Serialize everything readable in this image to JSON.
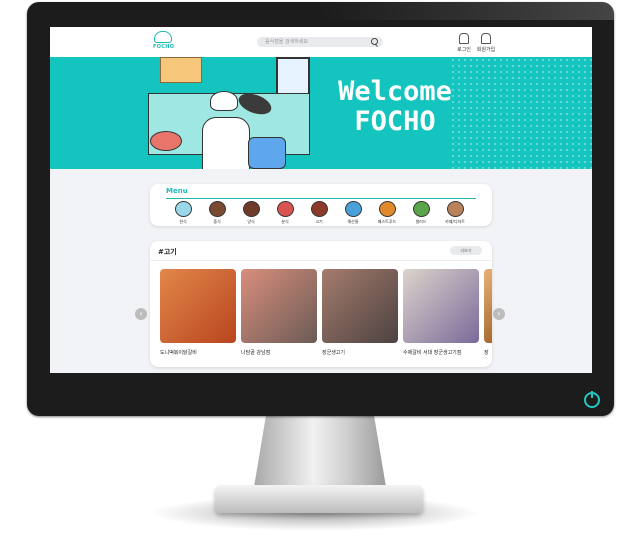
{
  "header": {
    "logo_text": "FOCHO",
    "search_placeholder": "음식점을 검색하세요",
    "actions": [
      {
        "label": "로그인",
        "icon": "user-icon"
      },
      {
        "label": "회원가입",
        "icon": "user-add-icon"
      }
    ]
  },
  "hero": {
    "title_line1": "Welcome",
    "title_line2": "FOCHO"
  },
  "menu": {
    "title": "Menu",
    "items": [
      {
        "label": "한식",
        "icon": "rice-bowl-icon",
        "color": "#9bd7ea"
      },
      {
        "label": "중식",
        "icon": "noodle-icon",
        "color": "#7a4a33"
      },
      {
        "label": "양식",
        "icon": "steak-icon",
        "color": "#6e3b2a"
      },
      {
        "label": "분식",
        "icon": "tteokbokki-icon",
        "color": "#d9534f"
      },
      {
        "label": "고기",
        "icon": "meat-icon",
        "color": "#8c3a2b"
      },
      {
        "label": "해산물",
        "icon": "seafood-icon",
        "color": "#4aa0d8"
      },
      {
        "label": "패스트푸드",
        "icon": "burger-icon",
        "color": "#e08a2c"
      },
      {
        "label": "샐러드",
        "icon": "salad-icon",
        "color": "#5aa54a"
      },
      {
        "label": "카페/디저트",
        "icon": "cake-icon",
        "color": "#b9825a"
      }
    ]
  },
  "restaurants": {
    "title": "#고기",
    "more_label": "더보기",
    "items": [
      {
        "name": "도니떡볶이닭갈비",
        "color_a": "#e2874a",
        "color_b": "#b8451f"
      },
      {
        "name": "나담골 강남점",
        "color_a": "#d98e7c",
        "color_b": "#6b5b56"
      },
      {
        "name": "장군생고기",
        "color_a": "#a57b6c",
        "color_b": "#4c4342"
      },
      {
        "name": "수제갈비 서대 장군생고기점",
        "color_a": "#dcd4cc",
        "color_b": "#7b6a9a"
      },
      {
        "name": "장",
        "color_a": "#e7b27a",
        "color_b": "#a66a2e"
      }
    ]
  },
  "nav": {
    "prev_symbol": "‹",
    "next_symbol": "›"
  }
}
